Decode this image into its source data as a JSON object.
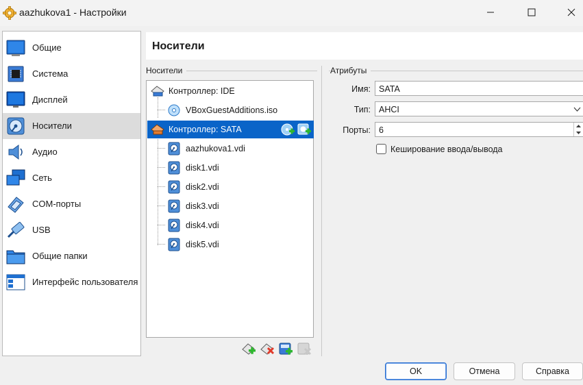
{
  "window": {
    "title": "aazhukova1 - Настройки",
    "icons": {
      "app": "gear-icon",
      "minimize": "minimize-icon",
      "maximize": "maximize-icon",
      "close": "close-icon"
    }
  },
  "sidebar": {
    "items": [
      {
        "label": "Общие",
        "icon": "general-icon"
      },
      {
        "label": "Система",
        "icon": "system-chip-icon"
      },
      {
        "label": "Дисплей",
        "icon": "display-icon"
      },
      {
        "label": "Носители",
        "icon": "storage-disk-icon",
        "selected": true
      },
      {
        "label": "Аудио",
        "icon": "audio-speaker-icon"
      },
      {
        "label": "Сеть",
        "icon": "network-icon"
      },
      {
        "label": "COM-порты",
        "icon": "serial-port-icon"
      },
      {
        "label": "USB",
        "icon": "usb-icon"
      },
      {
        "label": "Общие папки",
        "icon": "shared-folder-icon"
      },
      {
        "label": "Интерфейс пользователя",
        "icon": "user-interface-icon"
      }
    ]
  },
  "page": {
    "title": "Носители"
  },
  "storage": {
    "heading": "Носители",
    "tree": [
      {
        "label": "Контроллер: IDE",
        "kind": "controller"
      },
      {
        "label": "VBoxGuestAdditions.iso",
        "kind": "optical"
      },
      {
        "label": "Контроллер: SATA",
        "kind": "controller",
        "selected": true
      },
      {
        "label": "aazhukova1.vdi",
        "kind": "disk"
      },
      {
        "label": "disk1.vdi",
        "kind": "disk"
      },
      {
        "label": "disk2.vdi",
        "kind": "disk"
      },
      {
        "label": "disk3.vdi",
        "kind": "disk"
      },
      {
        "label": "disk4.vdi",
        "kind": "disk"
      },
      {
        "label": "disk5.vdi",
        "kind": "disk"
      }
    ],
    "toolbar_icons": [
      "add-controller-icon",
      "remove-controller-icon",
      "add-attachment-icon",
      "remove-attachment-icon"
    ]
  },
  "attributes": {
    "heading": "Атрибуты",
    "name_label": "Имя:",
    "name_value": "SATA",
    "type_label": "Тип:",
    "type_value": "AHCI",
    "ports_label": "Порты:",
    "ports_value": "6",
    "cache_label": "Кеширование ввода/вывода",
    "cache_checked": false
  },
  "buttons": {
    "ok": "OK",
    "cancel": "Отмена",
    "help": "Справка"
  },
  "colors": {
    "selection": "#0a64c8",
    "sidebar_selected": "#dcdcdc"
  }
}
